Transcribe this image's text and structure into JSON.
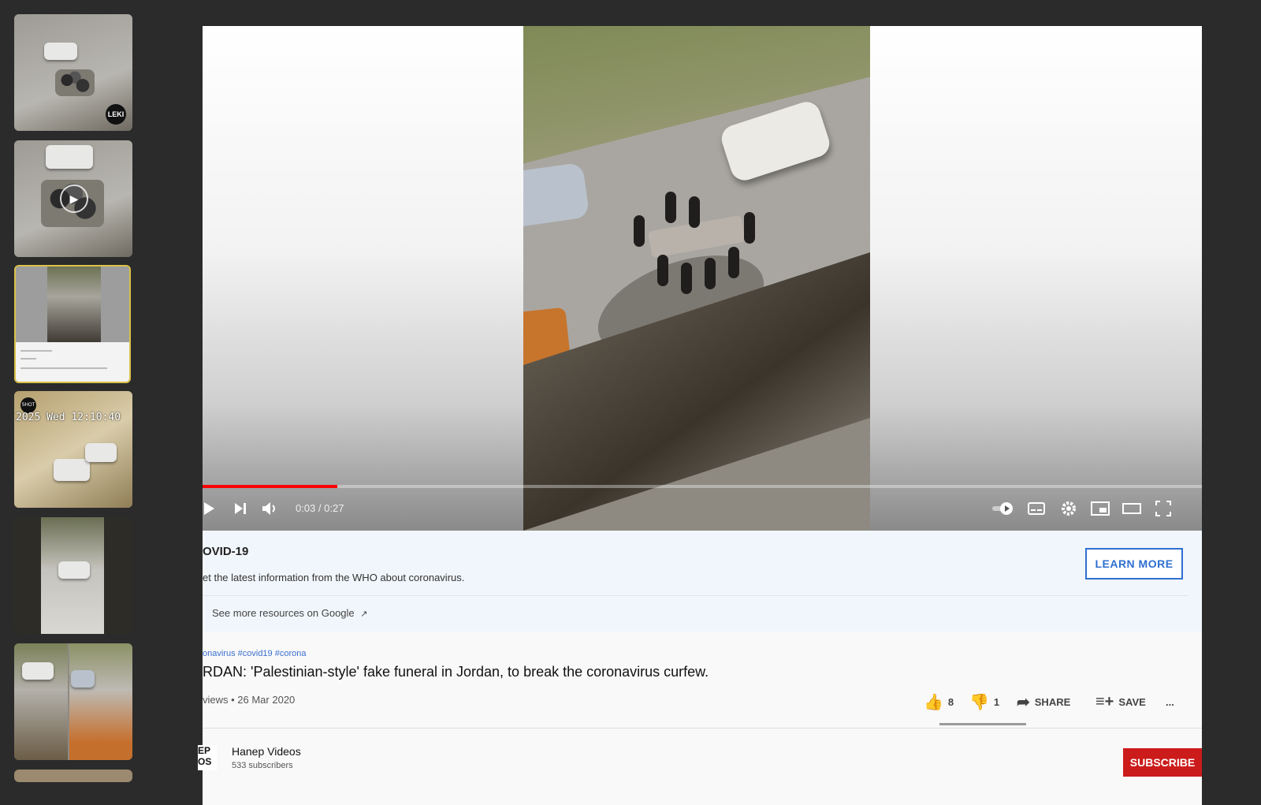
{
  "thumbnails": {
    "items": [
      {
        "kind": "funeral-with-car",
        "badge": "LEKI"
      },
      {
        "kind": "funeral-closeup-play"
      },
      {
        "kind": "player-screenshot",
        "selected": true
      },
      {
        "kind": "cctv",
        "timestamp": "2025 Wed 12:10:40",
        "badge": "SHOT"
      },
      {
        "kind": "street-vertical"
      },
      {
        "kind": "split-view"
      }
    ]
  },
  "player": {
    "time": "0:03 / 0:27",
    "progress_fraction": 0.135,
    "icons": {
      "play": "play-icon",
      "next": "next-icon",
      "volume": "volume-icon",
      "autoplay": "autoplay-toggle-icon",
      "captions": "captions-icon",
      "settings": "gear-icon",
      "miniplayer": "miniplayer-icon",
      "theater": "theater-icon",
      "fullscreen": "fullscreen-icon"
    }
  },
  "covid_panel": {
    "title": "OVID-19",
    "description": "et the latest information from the WHO about coronavirus.",
    "button": "LEARN MORE",
    "resources": "See more resources on Google"
  },
  "video_info": {
    "tags": "onavirus #covid19 #corona",
    "title": "RDAN: 'Palestinian-style' fake funeral in Jordan, to break the coronavirus curfew.",
    "meta": "views • 26 Mar 2020",
    "likes": "8",
    "dislikes": "1",
    "share_label": "SHARE",
    "save_label": "SAVE",
    "more": "..."
  },
  "channel": {
    "avatar_text": "EP\nOS",
    "name": "Hanep Videos",
    "subscribers": "533 subscribers",
    "subscribe_label": "SUBSCRIBE"
  },
  "colors": {
    "background": "#2b2b2b",
    "accent_red": "#cc1b1b",
    "link_blue": "#3a6fd0",
    "selected_border": "#d9c24a"
  }
}
